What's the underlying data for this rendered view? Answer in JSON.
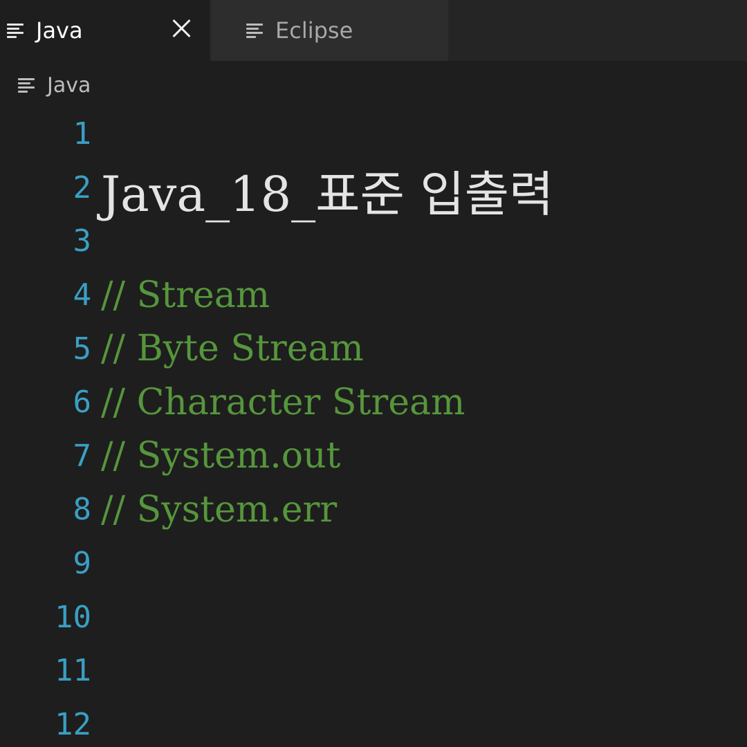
{
  "tabs": [
    {
      "label": "Java",
      "icon": "text-lines-icon",
      "active": true,
      "closable": true
    },
    {
      "label": "Eclipse",
      "icon": "text-lines-icon",
      "active": false,
      "closable": false
    }
  ],
  "breadcrumb": {
    "label": "Java",
    "icon": "text-lines-icon"
  },
  "editor": {
    "lines": [
      {
        "number": "1",
        "text": ""
      },
      {
        "number": "2",
        "text": "Java_18_표준 입출력"
      },
      {
        "number": "3",
        "text": ""
      },
      {
        "number": "4",
        "text": "// Stream"
      },
      {
        "number": "5",
        "text": "// Byte Stream"
      },
      {
        "number": "6",
        "text": "// Character Stream"
      },
      {
        "number": "7",
        "text": "// System.out"
      },
      {
        "number": "8",
        "text": "// System.err"
      },
      {
        "number": "9",
        "text": ""
      },
      {
        "number": "10",
        "text": ""
      },
      {
        "number": "11",
        "text": ""
      },
      {
        "number": "12",
        "text": ""
      }
    ]
  },
  "colors": {
    "background": "#1e1e1e",
    "tabbar": "#252526",
    "line_number": "#3a9fc4",
    "comment": "#56963c",
    "heading": "#e4e4e4"
  }
}
